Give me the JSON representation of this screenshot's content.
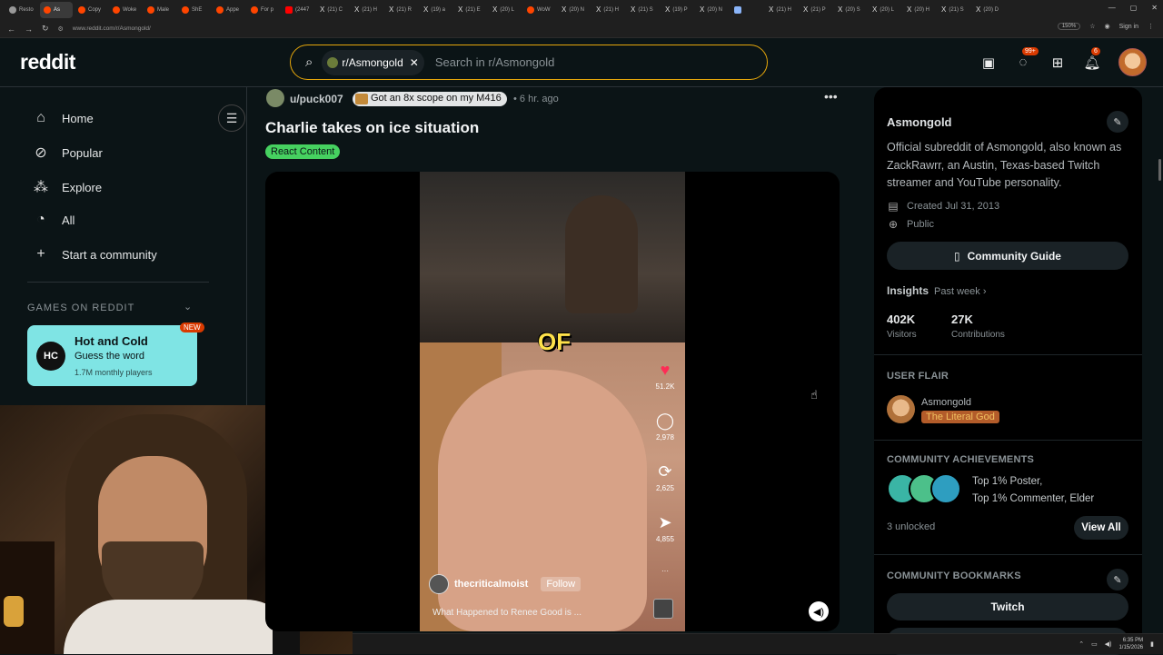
{
  "browser": {
    "tabs": [
      {
        "label": "Resto",
        "fav": "g"
      },
      {
        "label": "As",
        "fav": "reddit",
        "active": true
      },
      {
        "label": "Copy",
        "fav": "reddit"
      },
      {
        "label": "Woke",
        "fav": "reddit"
      },
      {
        "label": "Male",
        "fav": "reddit"
      },
      {
        "label": "ShE",
        "fav": "reddit"
      },
      {
        "label": "Appe",
        "fav": "reddit"
      },
      {
        "label": "For p",
        "fav": "reddit"
      },
      {
        "label": "(2447",
        "fav": "yt"
      },
      {
        "label": "(21) C",
        "fav": "x"
      },
      {
        "label": "(21) H",
        "fav": "x"
      },
      {
        "label": "(21) R",
        "fav": "x"
      },
      {
        "label": "(19) a",
        "fav": "x"
      },
      {
        "label": "(21) E",
        "fav": "x"
      },
      {
        "label": "(20) L",
        "fav": "x"
      },
      {
        "label": "WoW",
        "fav": "reddit"
      },
      {
        "label": "(20) N",
        "fav": "x"
      },
      {
        "label": "(21) H",
        "fav": "x"
      },
      {
        "label": "(21) S",
        "fav": "x"
      },
      {
        "label": "(19) P",
        "fav": "x"
      },
      {
        "label": "(20) N",
        "fav": "x"
      },
      {
        "label": "",
        "fav": "blue"
      },
      {
        "label": "(21) H",
        "fav": "x"
      },
      {
        "label": "(21) P",
        "fav": "x"
      },
      {
        "label": "(20) S",
        "fav": "x"
      },
      {
        "label": "(20) L",
        "fav": "x"
      },
      {
        "label": "(20) H",
        "fav": "x"
      },
      {
        "label": "(21) S",
        "fav": "x"
      },
      {
        "label": "(20) D",
        "fav": "x"
      }
    ],
    "url": "www.reddit.com/r/Asmongold/",
    "zoom": "150%",
    "signin": "Sign in"
  },
  "header": {
    "logo": "reddit",
    "search_chip": "r/Asmongold",
    "search_placeholder": "Search in r/Asmongold",
    "chat_badge": "99+",
    "notif_badge": "6"
  },
  "leftnav": {
    "items": [
      "Home",
      "Popular",
      "Explore",
      "All",
      "Start a community"
    ],
    "games_heading": "GAMES ON REDDIT",
    "game": {
      "title": "Hot and Cold",
      "subtitle": "Guess the word",
      "players": "1.7M monthly players",
      "badge": "NEW",
      "icon_text": "HC"
    }
  },
  "post": {
    "user": "u/puck007",
    "flair": "Got an 8x scope on my M416",
    "time": "• 6 hr. ago",
    "title": "Charlie takes on ice situation",
    "tag": "React Content",
    "video": {
      "overlay": "OF",
      "likes": "51.2K",
      "comments": "2,978",
      "reposts": "2,625",
      "shares": "4,855",
      "more": "···",
      "creator": "thecriticalmoist",
      "follow": "Follow",
      "caption": "What Happened to Renee Good is ..."
    }
  },
  "sidebar": {
    "name": "Asmongold",
    "description": "Official subreddit of Asmongold, also known as ZackRawrr, an Austin, Texas-based Twitch streamer and YouTube personality.",
    "created": "Created Jul 31, 2013",
    "visibility": "Public",
    "guide_button": "Community Guide",
    "insights_label": "Insights",
    "insights_period": "Past week ›",
    "visitors_value": "402K",
    "visitors_label": "Visitors",
    "contrib_value": "27K",
    "contrib_label": "Contributions",
    "user_flair_heading": "USER FLAIR",
    "flair_name": "Asmongold",
    "flair_tag": "The Literal God",
    "achievements_heading": "COMMUNITY ACHIEVEMENTS",
    "achievement_line1": "Top 1% Poster,",
    "achievement_line2": "Top 1% Commenter, Elder",
    "unlocked": "3 unlocked",
    "view_all": "View All",
    "bookmarks_heading": "COMMUNITY BOOKMARKS",
    "bookmark1": "Twitch"
  },
  "taskbar": {
    "time": "6:35 PM",
    "date": "1/15/2026"
  }
}
